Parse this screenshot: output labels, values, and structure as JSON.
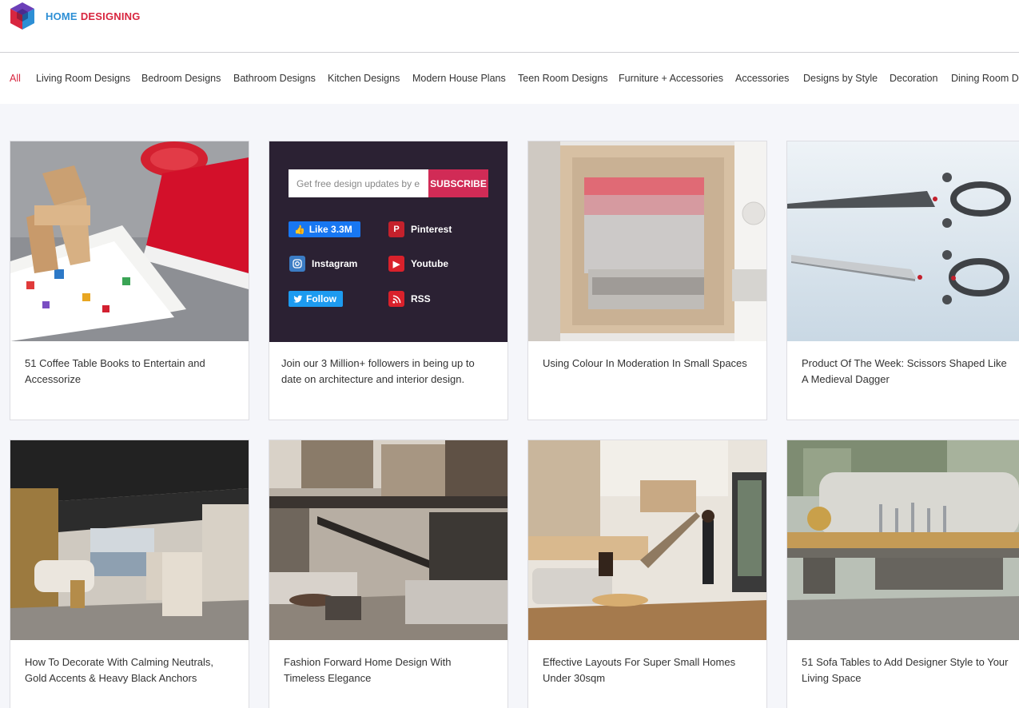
{
  "site": {
    "logo_word1": "HOME",
    "logo_word2": "DESIGNING",
    "colors": {
      "accent_red": "#d8263f",
      "accent_blue": "#2d8fd5",
      "newsletter_bg": "#2b2133",
      "subscribe_bg": "#d12b56"
    }
  },
  "nav": {
    "items": [
      "All",
      "Living Room Designs",
      "Bedroom Designs",
      "Bathroom Designs",
      "Kitchen Designs",
      "Modern House Plans",
      "Teen Room Designs",
      "Furniture + Accessories",
      "Accessories",
      "Designs by Style",
      "Decoration",
      "Dining Room Designs"
    ],
    "active": "All"
  },
  "cards": [
    {
      "title": "51 Coffee Table Books to Entertain and Accessorize"
    },
    {
      "title": "Using Colour In Moderation In Small Spaces"
    },
    {
      "title": "Product Of The Week: Scissors Shaped Like A Medieval Dagger"
    },
    {
      "title": "How To Decorate With Calming Neutrals, Gold Accents & Heavy Black Anchors"
    },
    {
      "title": "Fashion Forward Home Design With Timeless Elegance"
    },
    {
      "title": "Effective Layouts For Super Small Homes Under 30sqm"
    },
    {
      "title": "51 Sofa Tables to Add Designer Style to Your Living Space"
    }
  ],
  "newsletter": {
    "placeholder": "Get free design updates by email",
    "subscribe_label": "SUBSCRIBE",
    "facebook_label": "Like 3.3M",
    "pinterest_label": "Pinterest",
    "instagram_label": "Instagram",
    "youtube_label": "Youtube",
    "twitter_label": "Follow",
    "rss_label": "RSS",
    "text": "Join our 3 Million+ followers in being up to date on architecture and interior design."
  }
}
